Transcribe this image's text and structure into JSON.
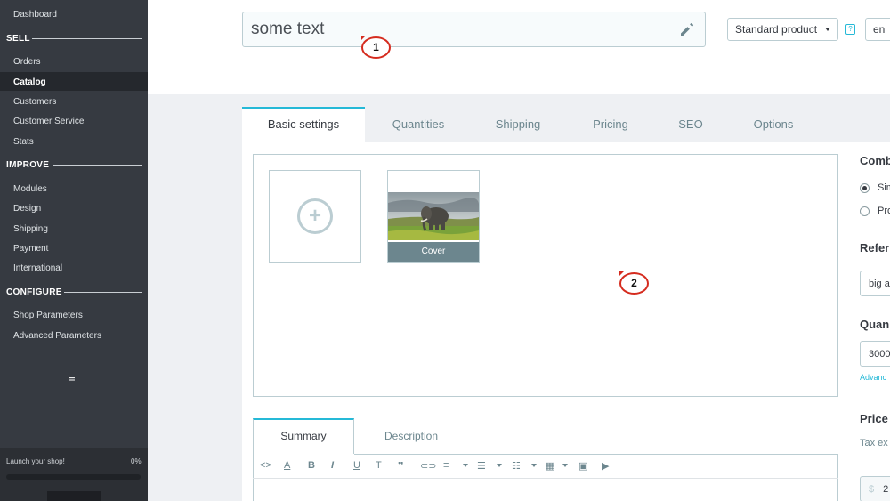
{
  "sidebar": {
    "dashboard": "Dashboard",
    "sections": [
      {
        "title": "SELL",
        "items": [
          "Orders",
          "Catalog",
          "Customers",
          "Customer Service",
          "Stats"
        ]
      },
      {
        "title": "IMPROVE",
        "items": [
          "Modules",
          "Design",
          "Shipping",
          "Payment",
          "International"
        ]
      },
      {
        "title": "CONFIGURE",
        "items": [
          "Shop Parameters",
          "Advanced Parameters"
        ]
      }
    ],
    "active_item": "Catalog",
    "menu_icon": "hamburger-icon",
    "launch": {
      "label": "Launch your shop!",
      "percent": "0%",
      "progress": 0
    }
  },
  "header": {
    "product_name": "some text",
    "edit_icon": "pencil-icon",
    "product_type": "Standard product",
    "help": "?",
    "language": "en"
  },
  "markers": [
    "1",
    "2"
  ],
  "tabs": [
    "Basic settings",
    "Quantities",
    "Shipping",
    "Pricing",
    "SEO",
    "Options"
  ],
  "images": {
    "add_icon": "plus-circle-icon",
    "cover_label": "Cover"
  },
  "editor": {
    "tabs": [
      "Summary",
      "Description"
    ],
    "toolbar_icons": [
      "code-icon",
      "text-color-icon",
      "bold-icon",
      "italic-icon",
      "underline-icon",
      "strikethrough-icon",
      "quote-icon",
      "link-icon",
      "align-icon",
      "bullet-list-icon",
      "numbered-list-icon",
      "table-icon",
      "image-icon",
      "media-icon"
    ]
  },
  "right_panel": {
    "combinations_heading": "Comb",
    "option_simple": "Sim",
    "option_combinations": "Pro",
    "reference_heading": "Refer",
    "reference_value": "big a",
    "quantity_heading": "Quan",
    "quantity_value": "3000",
    "advanced_link": "Advanc",
    "price_heading": "Price",
    "tax_label": "Tax ex",
    "currency": "$",
    "price_value": "2"
  },
  "colors": {
    "sidebar_bg": "#363a41",
    "accent": "#25b9d7",
    "marker": "#d52b1e"
  }
}
